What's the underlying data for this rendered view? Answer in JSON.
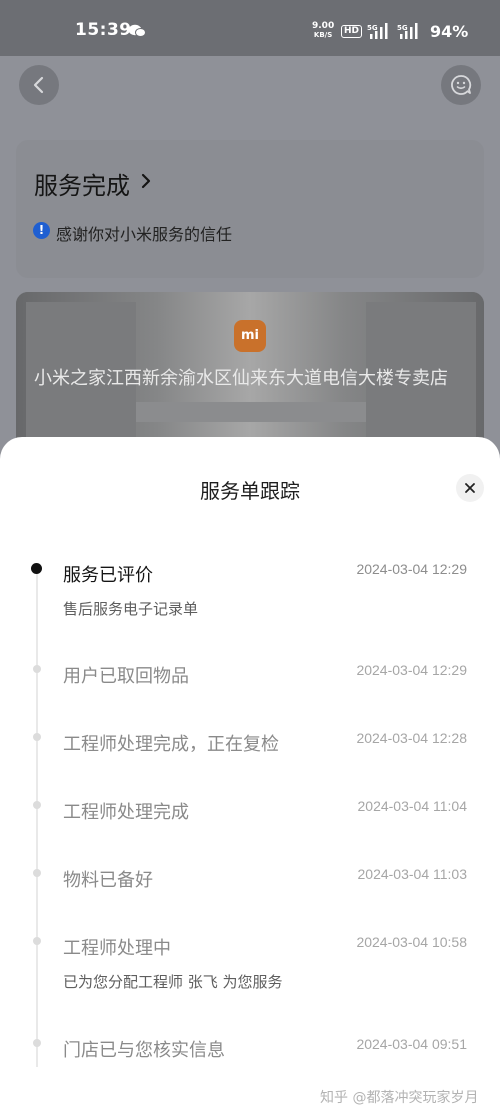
{
  "status_bar": {
    "time": "15:39",
    "net_speed_value": "9.00",
    "net_speed_unit": "KB/S",
    "hd_label": "HD",
    "battery": "94%"
  },
  "header": {
    "back_icon": "chevron-left-icon",
    "service_icon": "customer-service-icon"
  },
  "status_card": {
    "title": "服务完成",
    "message": "感谢你对小米服务的信任",
    "info_icon": "info-icon"
  },
  "store": {
    "logo_text": "mi",
    "name": "小米之家江西新余渝水区仙来东大道电信大楼专卖店"
  },
  "sheet": {
    "title": "服务单跟踪",
    "close_icon": "close-icon",
    "events": [
      {
        "title": "服务已评价",
        "time": "2024-03-04 12:29",
        "subtitle": "售后服务电子记录单"
      },
      {
        "title": "用户已取回物品",
        "time": "2024-03-04 12:29"
      },
      {
        "title": "工程师处理完成，正在复检",
        "time": "2024-03-04 12:28"
      },
      {
        "title": "工程师处理完成",
        "time": "2024-03-04 11:04"
      },
      {
        "title": "物料已备好",
        "time": "2024-03-04 11:03"
      },
      {
        "title": "工程师处理中",
        "time": "2024-03-04 10:58",
        "subtitle": "已为您分配工程师 张飞 为您服务"
      },
      {
        "title": "门店已与您核实信息",
        "time": "2024-03-04 09:51"
      }
    ]
  },
  "watermark": "知乎 @都落冲突玩家岁月",
  "colors": {
    "info_blue": "#1f5fd1",
    "active_dot": "#111111",
    "inactive_dot": "#dcdcdc"
  }
}
